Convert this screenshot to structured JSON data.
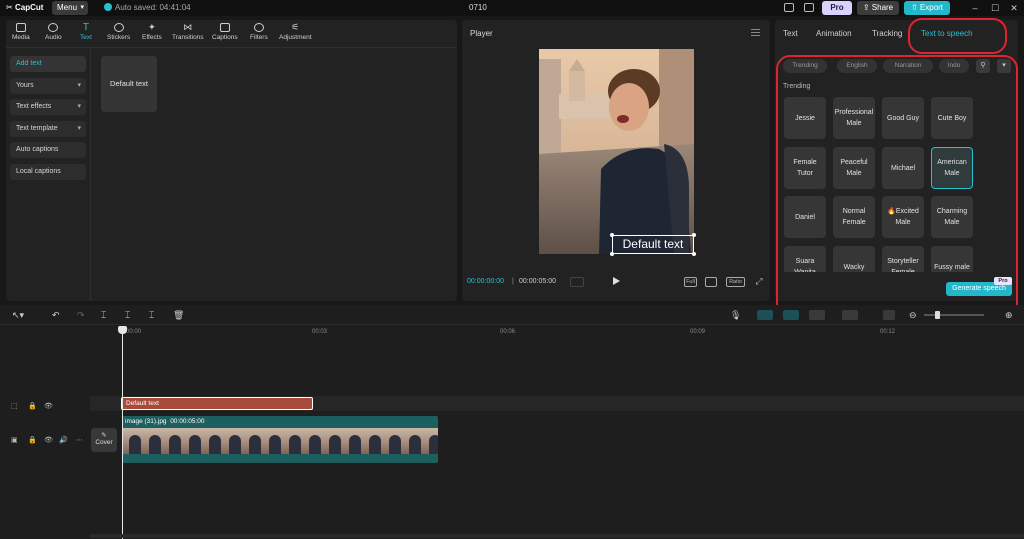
{
  "titlebar": {
    "app_name": "CapCut",
    "menu_label": "Menu",
    "autosave_text": "Auto saved: 04:41:04",
    "project_title": "0710",
    "pro_label": "Pro",
    "share_label": "Share",
    "export_label": "Export"
  },
  "toolbar": {
    "items": [
      {
        "label": "Media",
        "icon": "media-icon"
      },
      {
        "label": "Audio",
        "icon": "audio-icon"
      },
      {
        "label": "Text",
        "icon": "text-icon"
      },
      {
        "label": "Stickers",
        "icon": "stickers-icon"
      },
      {
        "label": "Effects",
        "icon": "effects-icon"
      },
      {
        "label": "Transitions",
        "icon": "transitions-icon"
      },
      {
        "label": "Captions",
        "icon": "captions-icon"
      },
      {
        "label": "Filters",
        "icon": "filters-icon"
      },
      {
        "label": "Adjustment",
        "icon": "adjustment-icon"
      }
    ],
    "active": "Text"
  },
  "text_sidebar": {
    "items": [
      "Add text",
      "Yours",
      "Text effects",
      "Text template",
      "Auto captions",
      "Local captions"
    ]
  },
  "text_library": {
    "default_card": "Default text"
  },
  "player": {
    "title": "Player",
    "overlay_text": "Default text",
    "time_current": "00:00:00:00",
    "time_separator": "|",
    "time_total": "00:00:05:00",
    "full_label": "Full",
    "ratio_label": "Ratio"
  },
  "right_panel": {
    "tabs": [
      "Text",
      "Animation",
      "Tracking",
      "Text to speech"
    ],
    "active_tab": "Text to speech",
    "filter_chips": [
      "Trending",
      "English",
      "Narration",
      "Indo"
    ],
    "section_label": "Trending",
    "voices": [
      "Jessie",
      "Professional Male",
      "Good Guy",
      "Cute Boy",
      "Female Tutor",
      "Peaceful Male",
      "Michael",
      "American Male",
      "Daniel",
      "Normal Female",
      "🔥Excited Male",
      "Charming Male",
      "Suara Wanita",
      "Wacky",
      "Storyteller Female",
      "Fussy male"
    ],
    "selected_voice": "American Male",
    "generate_label": "Generate speech",
    "pro_mini": "Pro"
  },
  "timeline": {
    "ruler_labels": [
      "00:00",
      "00:03",
      "00:06",
      "00:09",
      "00:12"
    ],
    "text_clip_label": "Default text",
    "video_clip_name": "image (31).jpg",
    "video_clip_duration": "00:00:05:00",
    "cover_label": "Cover"
  },
  "colors": {
    "accent": "#27c1d2",
    "highlight_ring": "#e0242f",
    "text_clip": "#a84a3a",
    "video_clip": "#1d5e5e"
  }
}
